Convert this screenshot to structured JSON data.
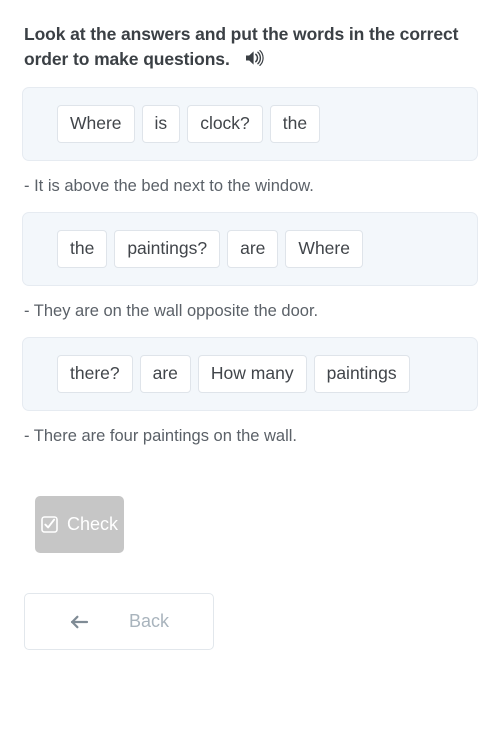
{
  "task": {
    "instruction": "Look at the answers and put the words in the correct order to make questions.",
    "audio_icon": "speaker-icon"
  },
  "exercises": [
    {
      "words": [
        "Where",
        "is",
        "clock?",
        "the"
      ],
      "answer": "- It is above the bed next to the window."
    },
    {
      "words": [
        "the",
        "paintings?",
        "are",
        "Where"
      ],
      "answer": "- They are on the wall opposite the door."
    },
    {
      "words": [
        "there?",
        "are",
        "How many",
        "paintings"
      ],
      "answer": "- There are four paintings on the wall."
    }
  ],
  "actions": {
    "check": {
      "label": "Check",
      "icon": "checked-box-icon",
      "background": "#c6c6c6",
      "text_color": "#ffffff",
      "disabled": true
    },
    "back": {
      "label": "Back",
      "icon": "arrow-left-icon",
      "background": "#ffffff",
      "text_color": "#a9b4bd"
    }
  },
  "theme": {
    "page_background": "#ffffff",
    "panel_background": "#f3f7fb",
    "panel_border": "#e6ebf1",
    "tile_background": "#ffffff",
    "tile_border": "#dfe4ea",
    "heading_color": "#3b4045",
    "answer_color": "#5b6168"
  }
}
